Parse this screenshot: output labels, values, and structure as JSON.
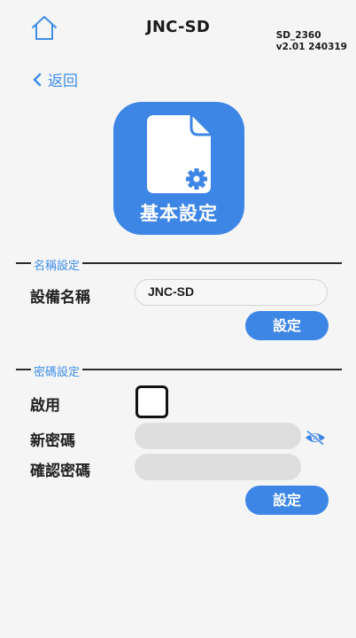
{
  "header": {
    "title": "JNC-SD",
    "model": "SD_2360",
    "version": "v2.01 240319",
    "home_icon": "home-icon"
  },
  "nav": {
    "back_label": "返回",
    "back_icon": "chevron-left-icon"
  },
  "app_tile": {
    "label": "基本設定",
    "icon": "document-gear-icon",
    "color": "#3e86e6"
  },
  "name_section": {
    "title": "名稱設定",
    "device_name_label": "設備名稱",
    "device_name_value": "JNC-SD",
    "set_button": "設定"
  },
  "password_section": {
    "title": "密碼設定",
    "enable_label": "啟用",
    "enable_checked": false,
    "new_password_label": "新密碼",
    "new_password_value": "",
    "confirm_password_label": "確認密碼",
    "confirm_password_value": "",
    "visibility_icon": "eye-slash-icon",
    "set_button": "設定"
  },
  "colors": {
    "accent": "#3e86e6",
    "link": "#3e8ee9",
    "background": "#f5f5f5"
  }
}
